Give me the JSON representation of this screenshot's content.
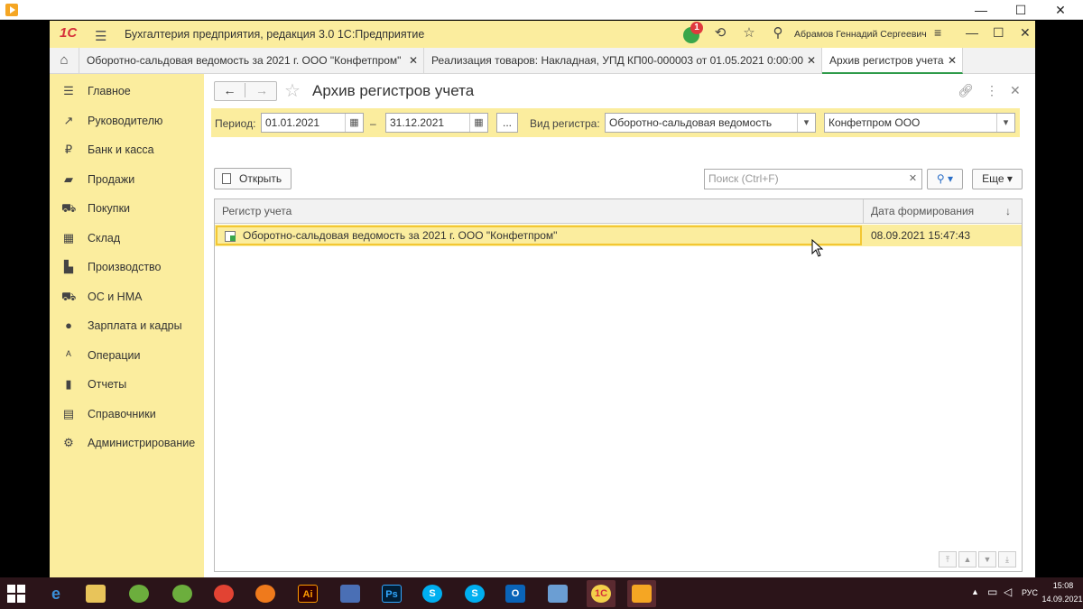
{
  "recorder": {
    "minimize": "—",
    "maximize": "☐",
    "close": "✕"
  },
  "app": {
    "logo": "1С",
    "title": "Бухгалтерия предприятия, редакция 3.0 1С:Предприятие",
    "notifications_count": "1",
    "user_name": "Абрамов Геннадий Сергеевич",
    "window_controls": {
      "minimize": "—",
      "maximize": "☐",
      "close": "✕"
    }
  },
  "tabs": [
    {
      "label": "Оборотно-сальдовая ведомость за 2021 г. ООО \"Конфетпром\"",
      "close": "✕"
    },
    {
      "label": "Реализация товаров: Накладная, УПД КП00-000003 от 01.05.2021 0:00:00",
      "close": "✕"
    },
    {
      "label": "Архив регистров учета",
      "close": "✕",
      "active": true
    }
  ],
  "sidebar": {
    "items": [
      {
        "label": "Главное",
        "icon": "menu-icon"
      },
      {
        "label": "Руководителю",
        "icon": "trend-icon"
      },
      {
        "label": "Банк и касса",
        "icon": "ruble-coin-icon"
      },
      {
        "label": "Продажи",
        "icon": "shopping-bag-icon"
      },
      {
        "label": "Покупки",
        "icon": "cart-icon"
      },
      {
        "label": "Склад",
        "icon": "warehouse-icon"
      },
      {
        "label": "Производство",
        "icon": "factory-icon"
      },
      {
        "label": "ОС и НМА",
        "icon": "truck-icon"
      },
      {
        "label": "Зарплата и кадры",
        "icon": "person-icon"
      },
      {
        "label": "Операции",
        "icon": "operations-icon"
      },
      {
        "label": "Отчеты",
        "icon": "bar-chart-icon"
      },
      {
        "label": "Справочники",
        "icon": "books-icon"
      },
      {
        "label": "Администрирование",
        "icon": "gear-icon"
      }
    ]
  },
  "form": {
    "title": "Архив регистров учета",
    "period_label": "Период:",
    "period_from": "01.01.2021",
    "dash": "–",
    "period_to": "31.12.2021",
    "ellipsis": "...",
    "register_type_label": "Вид регистра:",
    "register_type": "Оборотно-сальдовая ведомость",
    "organization": "Конфетпром ООО",
    "open_label": "Открыть",
    "search_placeholder": "Поиск (Ctrl+F)",
    "more_label": "Еще",
    "columns": [
      "Регистр учета",
      "Дата формирования"
    ],
    "rows": [
      {
        "register": "Оборотно-сальдовая ведомость за 2021 г. ООО \"Конфетпром\"",
        "date": "08.09.2021 15:47:43"
      }
    ]
  },
  "taskbar": {
    "lang": "РУС",
    "time": "15:08",
    "date": "14.09.2021"
  },
  "colors": {
    "accent_yellow": "#fbed9e",
    "selection_border": "#f3c733",
    "active_tab": "#2f9b4a",
    "taskbar": "#2b1419"
  }
}
